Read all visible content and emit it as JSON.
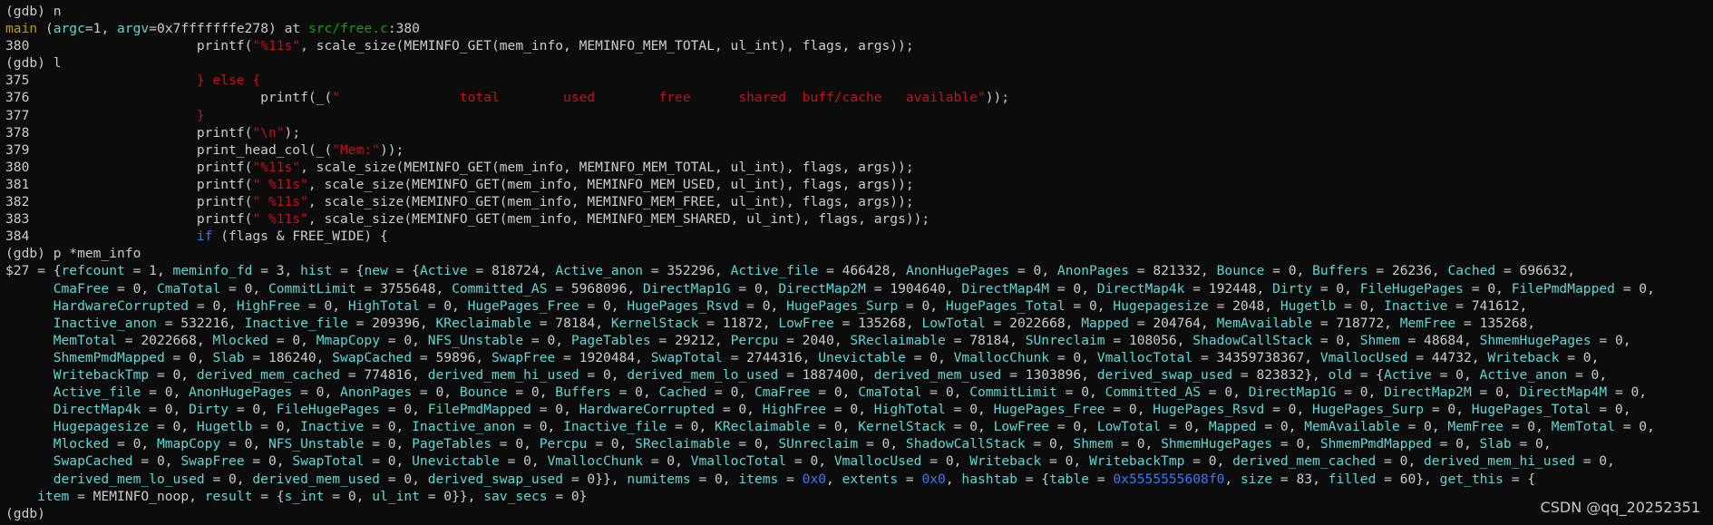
{
  "colors": {
    "default": "#cccccc",
    "red": "#c50f1f",
    "blue": "#3b78ff",
    "cyan": "#61d6d6",
    "green": "#13a10e",
    "yellow": "#c19c00",
    "white": "#f2f2f2"
  },
  "watermark": "CSDN @qq_20252351",
  "lines": [
    [
      [
        "w",
        "(gdb) n"
      ]
    ],
    [
      [
        "y",
        "main"
      ],
      [
        "w",
        " ("
      ],
      [
        "c",
        "argc"
      ],
      [
        "w",
        "=1, "
      ],
      [
        "c",
        "argv"
      ],
      [
        "w",
        "=0x7fffffffe278) at "
      ],
      [
        "g",
        "src/free.c"
      ],
      [
        "w",
        ":380"
      ]
    ],
    [
      [
        "w",
        "380                     printf("
      ],
      [
        "r",
        "\"%11s\""
      ],
      [
        "w",
        ", scale_size(MEMINFO_GET(mem_info, MEMINFO_MEM_TOTAL, ul_int), flags, args));"
      ]
    ],
    [
      [
        "w",
        "(gdb) l"
      ]
    ],
    [
      [
        "w",
        "375                     "
      ],
      [
        "r",
        "} else {"
      ]
    ],
    [
      [
        "w",
        "376                             printf(_("
      ],
      [
        "r",
        "\"               total        used        free      shared  buff/cache   available\""
      ],
      [
        "w",
        "));"
      ]
    ],
    [
      [
        "w",
        "377                     "
      ],
      [
        "r",
        "}"
      ]
    ],
    [
      [
        "w",
        "378                     printf("
      ],
      [
        "r",
        "\"\\n\""
      ],
      [
        "w",
        ");"
      ]
    ],
    [
      [
        "w",
        "379                     print_head_col(_("
      ],
      [
        "r",
        "\"Mem:\""
      ],
      [
        "w",
        "));"
      ]
    ],
    [
      [
        "w",
        "380                     printf("
      ],
      [
        "r",
        "\"%11s\""
      ],
      [
        "w",
        ", scale_size(MEMINFO_GET(mem_info, MEMINFO_MEM_TOTAL, ul_int), flags, args));"
      ]
    ],
    [
      [
        "w",
        "381                     printf("
      ],
      [
        "r",
        "\" %11s\""
      ],
      [
        "w",
        ", scale_size(MEMINFO_GET(mem_info, MEMINFO_MEM_USED, ul_int), flags, args));"
      ]
    ],
    [
      [
        "w",
        "382                     printf("
      ],
      [
        "r",
        "\" %11s\""
      ],
      [
        "w",
        ", scale_size(MEMINFO_GET(mem_info, MEMINFO_MEM_FREE, ul_int), flags, args));"
      ]
    ],
    [
      [
        "w",
        "383                     printf("
      ],
      [
        "r",
        "\" %11s\""
      ],
      [
        "w",
        ", scale_size(MEMINFO_GET(mem_info, MEMINFO_MEM_SHARED, ul_int), flags, args));"
      ]
    ],
    [
      [
        "w",
        "384                     "
      ],
      [
        "b",
        "if"
      ],
      [
        "w",
        " (flags & FREE_WIDE) {"
      ]
    ],
    [
      [
        "w",
        "(gdb) p *mem_info"
      ]
    ],
    [
      [
        "w",
        "$27 = {"
      ],
      [
        "c",
        "refcount"
      ],
      [
        "w",
        " = 1, "
      ],
      [
        "c",
        "meminfo_fd"
      ],
      [
        "w",
        " = 3, "
      ],
      [
        "c",
        "hist"
      ],
      [
        "w",
        " = {"
      ],
      [
        "c",
        "new"
      ],
      [
        "w",
        " = {"
      ],
      [
        "c",
        "Active"
      ],
      [
        "w",
        " = 818724, "
      ],
      [
        "c",
        "Active_anon"
      ],
      [
        "w",
        " = 352296, "
      ],
      [
        "c",
        "Active_file"
      ],
      [
        "w",
        " = 466428, "
      ],
      [
        "c",
        "AnonHugePages"
      ],
      [
        "w",
        " = 0, "
      ],
      [
        "c",
        "AnonPages"
      ],
      [
        "w",
        " = 821332, "
      ],
      [
        "c",
        "Bounce"
      ],
      [
        "w",
        " = 0, "
      ],
      [
        "c",
        "Buffers"
      ],
      [
        "w",
        " = 26236, "
      ],
      [
        "c",
        "Cached"
      ],
      [
        "w",
        " = 696632,"
      ]
    ],
    [
      [
        "w",
        "      "
      ],
      [
        "c",
        "CmaFree"
      ],
      [
        "w",
        " = 0, "
      ],
      [
        "c",
        "CmaTotal"
      ],
      [
        "w",
        " = 0, "
      ],
      [
        "c",
        "CommitLimit"
      ],
      [
        "w",
        " = 3755648, "
      ],
      [
        "c",
        "Committed_AS"
      ],
      [
        "w",
        " = 5968096, "
      ],
      [
        "c",
        "DirectMap1G"
      ],
      [
        "w",
        " = 0, "
      ],
      [
        "c",
        "DirectMap2M"
      ],
      [
        "w",
        " = 1904640, "
      ],
      [
        "c",
        "DirectMap4M"
      ],
      [
        "w",
        " = 0, "
      ],
      [
        "c",
        "DirectMap4k"
      ],
      [
        "w",
        " = 192448, "
      ],
      [
        "c",
        "Dirty"
      ],
      [
        "w",
        " = 0, "
      ],
      [
        "c",
        "FileHugePages"
      ],
      [
        "w",
        " = 0, "
      ],
      [
        "c",
        "FilePmdMapped"
      ],
      [
        "w",
        " = 0,"
      ]
    ],
    [
      [
        "w",
        "      "
      ],
      [
        "c",
        "HardwareCorrupted"
      ],
      [
        "w",
        " = 0, "
      ],
      [
        "c",
        "HighFree"
      ],
      [
        "w",
        " = 0, "
      ],
      [
        "c",
        "HighTotal"
      ],
      [
        "w",
        " = 0, "
      ],
      [
        "c",
        "HugePages_Free"
      ],
      [
        "w",
        " = 0, "
      ],
      [
        "c",
        "HugePages_Rsvd"
      ],
      [
        "w",
        " = 0, "
      ],
      [
        "c",
        "HugePages_Surp"
      ],
      [
        "w",
        " = 0, "
      ],
      [
        "c",
        "HugePages_Total"
      ],
      [
        "w",
        " = 0, "
      ],
      [
        "c",
        "Hugepagesize"
      ],
      [
        "w",
        " = 2048, "
      ],
      [
        "c",
        "Hugetlb"
      ],
      [
        "w",
        " = 0, "
      ],
      [
        "c",
        "Inactive"
      ],
      [
        "w",
        " = 741612,"
      ]
    ],
    [
      [
        "w",
        "      "
      ],
      [
        "c",
        "Inactive_anon"
      ],
      [
        "w",
        " = 532216, "
      ],
      [
        "c",
        "Inactive_file"
      ],
      [
        "w",
        " = 209396, "
      ],
      [
        "c",
        "KReclaimable"
      ],
      [
        "w",
        " = 78184, "
      ],
      [
        "c",
        "KernelStack"
      ],
      [
        "w",
        " = 11872, "
      ],
      [
        "c",
        "LowFree"
      ],
      [
        "w",
        " = 135268, "
      ],
      [
        "c",
        "LowTotal"
      ],
      [
        "w",
        " = 2022668, "
      ],
      [
        "c",
        "Mapped"
      ],
      [
        "w",
        " = 204764, "
      ],
      [
        "c",
        "MemAvailable"
      ],
      [
        "w",
        " = 718772, "
      ],
      [
        "c",
        "MemFree"
      ],
      [
        "w",
        " = 135268,"
      ]
    ],
    [
      [
        "w",
        "      "
      ],
      [
        "c",
        "MemTotal"
      ],
      [
        "w",
        " = 2022668, "
      ],
      [
        "c",
        "Mlocked"
      ],
      [
        "w",
        " = 0, "
      ],
      [
        "c",
        "MmapCopy"
      ],
      [
        "w",
        " = 0, "
      ],
      [
        "c",
        "NFS_Unstable"
      ],
      [
        "w",
        " = 0, "
      ],
      [
        "c",
        "PageTables"
      ],
      [
        "w",
        " = 29212, "
      ],
      [
        "c",
        "Percpu"
      ],
      [
        "w",
        " = 2040, "
      ],
      [
        "c",
        "SReclaimable"
      ],
      [
        "w",
        " = 78184, "
      ],
      [
        "c",
        "SUnreclaim"
      ],
      [
        "w",
        " = 108056, "
      ],
      [
        "c",
        "ShadowCallStack"
      ],
      [
        "w",
        " = 0, "
      ],
      [
        "c",
        "Shmem"
      ],
      [
        "w",
        " = 48684, "
      ],
      [
        "c",
        "ShmemHugePages"
      ],
      [
        "w",
        " = 0,"
      ]
    ],
    [
      [
        "w",
        "      "
      ],
      [
        "c",
        "ShmemPmdMapped"
      ],
      [
        "w",
        " = 0, "
      ],
      [
        "c",
        "Slab"
      ],
      [
        "w",
        " = 186240, "
      ],
      [
        "c",
        "SwapCached"
      ],
      [
        "w",
        " = 59896, "
      ],
      [
        "c",
        "SwapFree"
      ],
      [
        "w",
        " = 1920484, "
      ],
      [
        "c",
        "SwapTotal"
      ],
      [
        "w",
        " = 2744316, "
      ],
      [
        "c",
        "Unevictable"
      ],
      [
        "w",
        " = 0, "
      ],
      [
        "c",
        "VmallocChunk"
      ],
      [
        "w",
        " = 0, "
      ],
      [
        "c",
        "VmallocTotal"
      ],
      [
        "w",
        " = 34359738367, "
      ],
      [
        "c",
        "VmallocUsed"
      ],
      [
        "w",
        " = 44732, "
      ],
      [
        "c",
        "Writeback"
      ],
      [
        "w",
        " = 0,"
      ]
    ],
    [
      [
        "w",
        "      "
      ],
      [
        "c",
        "WritebackTmp"
      ],
      [
        "w",
        " = 0, "
      ],
      [
        "c",
        "derived_mem_cached"
      ],
      [
        "w",
        " = 774816, "
      ],
      [
        "c",
        "derived_mem_hi_used"
      ],
      [
        "w",
        " = 0, "
      ],
      [
        "c",
        "derived_mem_lo_used"
      ],
      [
        "w",
        " = 1887400, "
      ],
      [
        "c",
        "derived_mem_used"
      ],
      [
        "w",
        " = 1303896, "
      ],
      [
        "c",
        "derived_swap_used"
      ],
      [
        "w",
        " = 823832}, "
      ],
      [
        "c",
        "old"
      ],
      [
        "w",
        " = {"
      ],
      [
        "c",
        "Active"
      ],
      [
        "w",
        " = 0, "
      ],
      [
        "c",
        "Active_anon"
      ],
      [
        "w",
        " = 0,"
      ]
    ],
    [
      [
        "w",
        "      "
      ],
      [
        "c",
        "Active_file"
      ],
      [
        "w",
        " = 0, "
      ],
      [
        "c",
        "AnonHugePages"
      ],
      [
        "w",
        " = 0, "
      ],
      [
        "c",
        "AnonPages"
      ],
      [
        "w",
        " = 0, "
      ],
      [
        "c",
        "Bounce"
      ],
      [
        "w",
        " = 0, "
      ],
      [
        "c",
        "Buffers"
      ],
      [
        "w",
        " = 0, "
      ],
      [
        "c",
        "Cached"
      ],
      [
        "w",
        " = 0, "
      ],
      [
        "c",
        "CmaFree"
      ],
      [
        "w",
        " = 0, "
      ],
      [
        "c",
        "CmaTotal"
      ],
      [
        "w",
        " = 0, "
      ],
      [
        "c",
        "CommitLimit"
      ],
      [
        "w",
        " = 0, "
      ],
      [
        "c",
        "Committed_AS"
      ],
      [
        "w",
        " = 0, "
      ],
      [
        "c",
        "DirectMap1G"
      ],
      [
        "w",
        " = 0, "
      ],
      [
        "c",
        "DirectMap2M"
      ],
      [
        "w",
        " = 0, "
      ],
      [
        "c",
        "DirectMap4M"
      ],
      [
        "w",
        " = 0,"
      ]
    ],
    [
      [
        "w",
        "      "
      ],
      [
        "c",
        "DirectMap4k"
      ],
      [
        "w",
        " = 0, "
      ],
      [
        "c",
        "Dirty"
      ],
      [
        "w",
        " = 0, "
      ],
      [
        "c",
        "FileHugePages"
      ],
      [
        "w",
        " = 0, "
      ],
      [
        "c",
        "FilePmdMapped"
      ],
      [
        "w",
        " = 0, "
      ],
      [
        "c",
        "HardwareCorrupted"
      ],
      [
        "w",
        " = 0, "
      ],
      [
        "c",
        "HighFree"
      ],
      [
        "w",
        " = 0, "
      ],
      [
        "c",
        "HighTotal"
      ],
      [
        "w",
        " = 0, "
      ],
      [
        "c",
        "HugePages_Free"
      ],
      [
        "w",
        " = 0, "
      ],
      [
        "c",
        "HugePages_Rsvd"
      ],
      [
        "w",
        " = 0, "
      ],
      [
        "c",
        "HugePages_Surp"
      ],
      [
        "w",
        " = 0, "
      ],
      [
        "c",
        "HugePages_Total"
      ],
      [
        "w",
        " = 0,"
      ]
    ],
    [
      [
        "w",
        "      "
      ],
      [
        "c",
        "Hugepagesize"
      ],
      [
        "w",
        " = 0, "
      ],
      [
        "c",
        "Hugetlb"
      ],
      [
        "w",
        " = 0, "
      ],
      [
        "c",
        "Inactive"
      ],
      [
        "w",
        " = 0, "
      ],
      [
        "c",
        "Inactive_anon"
      ],
      [
        "w",
        " = 0, "
      ],
      [
        "c",
        "Inactive_file"
      ],
      [
        "w",
        " = 0, "
      ],
      [
        "c",
        "KReclaimable"
      ],
      [
        "w",
        " = 0, "
      ],
      [
        "c",
        "KernelStack"
      ],
      [
        "w",
        " = 0, "
      ],
      [
        "c",
        "LowFree"
      ],
      [
        "w",
        " = 0, "
      ],
      [
        "c",
        "LowTotal"
      ],
      [
        "w",
        " = 0, "
      ],
      [
        "c",
        "Mapped"
      ],
      [
        "w",
        " = 0, "
      ],
      [
        "c",
        "MemAvailable"
      ],
      [
        "w",
        " = 0, "
      ],
      [
        "c",
        "MemFree"
      ],
      [
        "w",
        " = 0, "
      ],
      [
        "c",
        "MemTotal"
      ],
      [
        "w",
        " = 0,"
      ]
    ],
    [
      [
        "w",
        "      "
      ],
      [
        "c",
        "Mlocked"
      ],
      [
        "w",
        " = 0, "
      ],
      [
        "c",
        "MmapCopy"
      ],
      [
        "w",
        " = 0, "
      ],
      [
        "c",
        "NFS_Unstable"
      ],
      [
        "w",
        " = 0, "
      ],
      [
        "c",
        "PageTables"
      ],
      [
        "w",
        " = 0, "
      ],
      [
        "c",
        "Percpu"
      ],
      [
        "w",
        " = 0, "
      ],
      [
        "c",
        "SReclaimable"
      ],
      [
        "w",
        " = 0, "
      ],
      [
        "c",
        "SUnreclaim"
      ],
      [
        "w",
        " = 0, "
      ],
      [
        "c",
        "ShadowCallStack"
      ],
      [
        "w",
        " = 0, "
      ],
      [
        "c",
        "Shmem"
      ],
      [
        "w",
        " = 0, "
      ],
      [
        "c",
        "ShmemHugePages"
      ],
      [
        "w",
        " = 0, "
      ],
      [
        "c",
        "ShmemPmdMapped"
      ],
      [
        "w",
        " = 0, "
      ],
      [
        "c",
        "Slab"
      ],
      [
        "w",
        " = 0,"
      ]
    ],
    [
      [
        "w",
        "      "
      ],
      [
        "c",
        "SwapCached"
      ],
      [
        "w",
        " = 0, "
      ],
      [
        "c",
        "SwapFree"
      ],
      [
        "w",
        " = 0, "
      ],
      [
        "c",
        "SwapTotal"
      ],
      [
        "w",
        " = 0, "
      ],
      [
        "c",
        "Unevictable"
      ],
      [
        "w",
        " = 0, "
      ],
      [
        "c",
        "VmallocChunk"
      ],
      [
        "w",
        " = 0, "
      ],
      [
        "c",
        "VmallocTotal"
      ],
      [
        "w",
        " = 0, "
      ],
      [
        "c",
        "VmallocUsed"
      ],
      [
        "w",
        " = 0, "
      ],
      [
        "c",
        "Writeback"
      ],
      [
        "w",
        " = 0, "
      ],
      [
        "c",
        "WritebackTmp"
      ],
      [
        "w",
        " = 0, "
      ],
      [
        "c",
        "derived_mem_cached"
      ],
      [
        "w",
        " = 0, "
      ],
      [
        "c",
        "derived_mem_hi_used"
      ],
      [
        "w",
        " = 0,"
      ]
    ],
    [
      [
        "w",
        "      "
      ],
      [
        "c",
        "derived_mem_lo_used"
      ],
      [
        "w",
        " = 0, "
      ],
      [
        "c",
        "derived_mem_used"
      ],
      [
        "w",
        " = 0, "
      ],
      [
        "c",
        "derived_swap_used"
      ],
      [
        "w",
        " = 0}}, "
      ],
      [
        "c",
        "numitems"
      ],
      [
        "w",
        " = 0, "
      ],
      [
        "c",
        "items"
      ],
      [
        "w",
        " = "
      ],
      [
        "b",
        "0x0"
      ],
      [
        "w",
        ", "
      ],
      [
        "c",
        "extents"
      ],
      [
        "w",
        " = "
      ],
      [
        "b",
        "0x0"
      ],
      [
        "w",
        ", "
      ],
      [
        "c",
        "hashtab"
      ],
      [
        "w",
        " = {"
      ],
      [
        "c",
        "table"
      ],
      [
        "w",
        " = "
      ],
      [
        "b",
        "0x5555555608f0"
      ],
      [
        "w",
        ", "
      ],
      [
        "c",
        "size"
      ],
      [
        "w",
        " = 83, "
      ],
      [
        "c",
        "filled"
      ],
      [
        "w",
        " = 60}, "
      ],
      [
        "c",
        "get_this"
      ],
      [
        "w",
        " = {"
      ]
    ],
    [
      [
        "w",
        "    "
      ],
      [
        "c",
        "item"
      ],
      [
        "w",
        " = MEMINFO_noop, "
      ],
      [
        "c",
        "result"
      ],
      [
        "w",
        " = {"
      ],
      [
        "c",
        "s_int"
      ],
      [
        "w",
        " = 0, "
      ],
      [
        "c",
        "ul_int"
      ],
      [
        "w",
        " = 0}}, "
      ],
      [
        "c",
        "sav_secs"
      ],
      [
        "w",
        " = 0}"
      ]
    ],
    [
      [
        "w",
        "(gdb) "
      ]
    ]
  ]
}
